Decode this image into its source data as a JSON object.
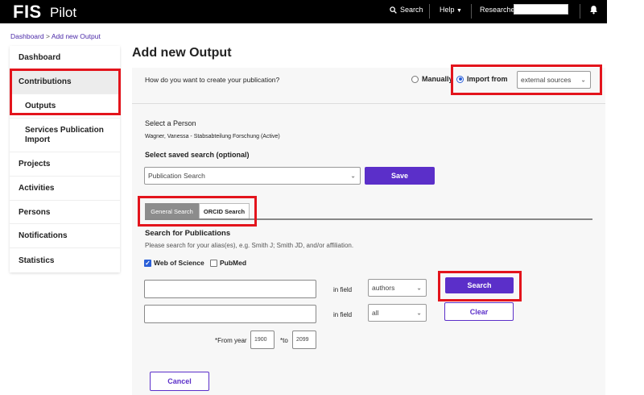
{
  "header": {
    "logo": "FIS",
    "logo_sub": "Pilot",
    "search_label": "Search",
    "help_label": "Help",
    "role_label": "Researcher"
  },
  "breadcrumb": {
    "home": "Dashboard",
    "separator": ">",
    "current": "Add new Output"
  },
  "sidebar": {
    "items": [
      {
        "label": "Dashboard"
      },
      {
        "label": "Contributions"
      },
      {
        "label": "Outputs"
      },
      {
        "label": "Services Publication Import"
      },
      {
        "label": "Projects"
      },
      {
        "label": "Activities"
      },
      {
        "label": "Persons"
      },
      {
        "label": "Notifications"
      },
      {
        "label": "Statistics"
      }
    ]
  },
  "page": {
    "title": "Add new Output",
    "question": "How do you want to create your publication?",
    "option_manual": "Manually",
    "option_import": "Import from",
    "import_source": "external sources"
  },
  "person": {
    "heading": "Select a Person",
    "value": "Wagner, Vanessa - Stabsabteilung Forschung (Active)"
  },
  "saved_search": {
    "heading": "Select saved search (optional)",
    "value": "Publication Search",
    "save_label": "Save"
  },
  "tabs": {
    "general": "General Search",
    "orcid": "ORCID Search"
  },
  "search": {
    "heading": "Search for Publications",
    "hint": "Please search for your alias(es), e.g. Smith J; Smith JD, and/or affiliation.",
    "sources": [
      {
        "label": "Web of Science",
        "checked": true
      },
      {
        "label": "PubMed",
        "checked": false
      }
    ],
    "row1": {
      "value": "",
      "in_field": "in field",
      "field": "authors"
    },
    "row2": {
      "value": "",
      "in_field": "in field",
      "field": "all"
    },
    "search_label": "Search",
    "clear_label": "Clear",
    "from_label": "*From year",
    "from_value": "1900",
    "to_label": "*to",
    "to_value": "2099"
  },
  "footer": {
    "cancel_label": "Cancel"
  },
  "colors": {
    "accent": "#5b2fc9",
    "highlight": "#e3141c",
    "header_bg": "#000000"
  }
}
